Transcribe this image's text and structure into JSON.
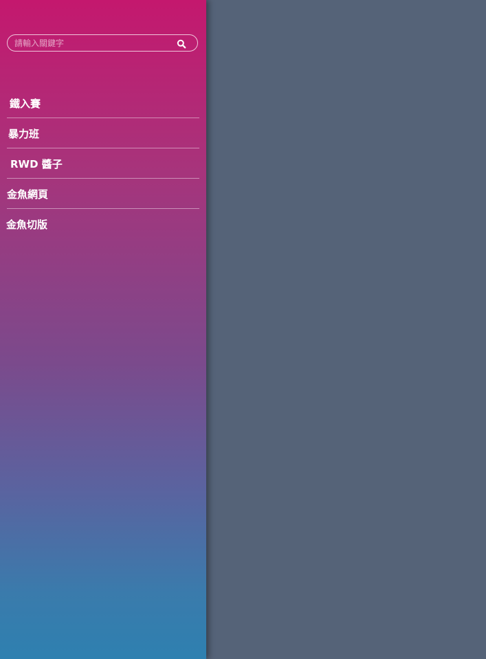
{
  "search": {
    "placeholder": "請輸入關鍵字",
    "button_icon": "search-icon"
  },
  "nav": {
    "items": [
      {
        "label": "鐵入賽"
      },
      {
        "label": "暴力班"
      },
      {
        "label": "RWD 醬子"
      },
      {
        "label": "金魚網頁"
      },
      {
        "label": "金魚切版"
      }
    ]
  },
  "colors": {
    "sidebar_top": "#c4186e",
    "sidebar_bottom": "#2e80b0",
    "main_background": "#556378"
  }
}
